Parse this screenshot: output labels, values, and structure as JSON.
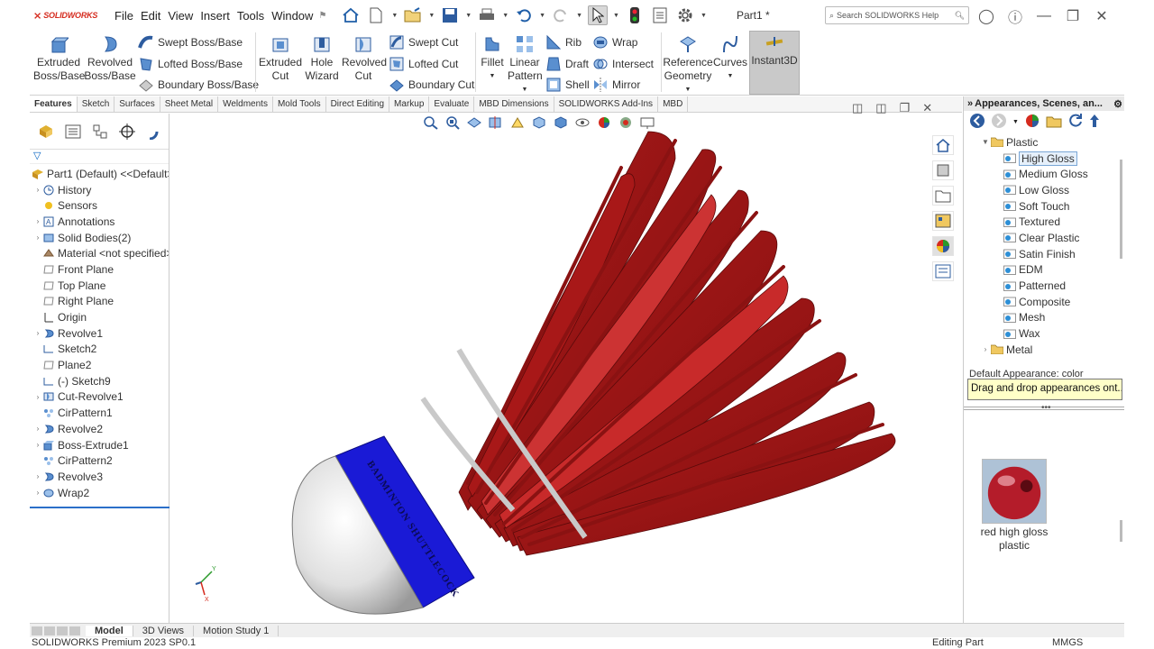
{
  "app": {
    "brand": "SOLIDWORKS",
    "document_title": "Part1 *",
    "search_placeholder": "Search SOLIDWORKS Help"
  },
  "menu": [
    "File",
    "Edit",
    "View",
    "Insert",
    "Tools",
    "Window"
  ],
  "ribbon": {
    "extruded_boss": "Extruded Boss/Base",
    "revolved_boss": "Revolved Boss/Base",
    "swept_boss": "Swept Boss/Base",
    "lofted_boss": "Lofted Boss/Base",
    "boundary_boss": "Boundary Boss/Base",
    "extruded_cut": "Extruded Cut",
    "hole_wizard": "Hole Wizard",
    "revolved_cut": "Revolved Cut",
    "swept_cut": "Swept Cut",
    "lofted_cut": "Lofted Cut",
    "boundary_cut": "Boundary Cut",
    "fillet": "Fillet",
    "linear_pattern": "Linear Pattern",
    "rib": "Rib",
    "draft": "Draft",
    "shell": "Shell",
    "wrap": "Wrap",
    "intersect": "Intersect",
    "mirror": "Mirror",
    "reference_geometry": "Reference Geometry",
    "curves": "Curves",
    "instant3d": "Instant3D"
  },
  "command_tabs": [
    "Features",
    "Sketch",
    "Surfaces",
    "Sheet Metal",
    "Weldments",
    "Mold Tools",
    "Direct Editing",
    "Markup",
    "Evaluate",
    "MBD Dimensions",
    "SOLIDWORKS Add-Ins",
    "MBD"
  ],
  "feature_tree": {
    "root": "Part1 (Default) <<Default>_",
    "items": [
      {
        "label": "History",
        "expand": true,
        "icon": "history"
      },
      {
        "label": "Sensors",
        "expand": false,
        "icon": "sensor"
      },
      {
        "label": "Annotations",
        "expand": true,
        "icon": "annotation"
      },
      {
        "label": "Solid Bodies(2)",
        "expand": true,
        "icon": "bodies"
      },
      {
        "label": "Material <not specified>",
        "expand": false,
        "icon": "material"
      },
      {
        "label": "Front Plane",
        "expand": false,
        "icon": "plane"
      },
      {
        "label": "Top Plane",
        "expand": false,
        "icon": "plane"
      },
      {
        "label": "Right Plane",
        "expand": false,
        "icon": "plane"
      },
      {
        "label": "Origin",
        "expand": false,
        "icon": "origin"
      },
      {
        "label": "Revolve1",
        "expand": true,
        "icon": "revolve"
      },
      {
        "label": "Sketch2",
        "expand": false,
        "icon": "sketch"
      },
      {
        "label": "Plane2",
        "expand": false,
        "icon": "plane"
      },
      {
        "label": "(-) Sketch9",
        "expand": false,
        "icon": "sketch"
      },
      {
        "label": "Cut-Revolve1",
        "expand": true,
        "icon": "cut"
      },
      {
        "label": "CirPattern1",
        "expand": false,
        "icon": "pattern"
      },
      {
        "label": "Revolve2",
        "expand": true,
        "icon": "revolve"
      },
      {
        "label": "Boss-Extrude1",
        "expand": true,
        "icon": "extrude"
      },
      {
        "label": "CirPattern2",
        "expand": false,
        "icon": "pattern"
      },
      {
        "label": "Revolve3",
        "expand": true,
        "icon": "revolve"
      },
      {
        "label": "Wrap2",
        "expand": true,
        "icon": "wrap"
      }
    ]
  },
  "task_pane": {
    "title": "Appearances, Scenes, an...",
    "plastic_label": "Plastic",
    "plastic_items": [
      "High Gloss",
      "Medium Gloss",
      "Low Gloss",
      "Soft Touch",
      "Textured",
      "Clear Plastic",
      "Satin Finish",
      "EDM",
      "Patterned",
      "Composite",
      "Mesh",
      "Wax"
    ],
    "selected_item": "High Gloss",
    "metal_label": "Metal",
    "default_appearance": "Default Appearance: color",
    "tooltip": "Drag and drop appearances ont...",
    "swatch_label": "red high gloss plastic"
  },
  "bottom_tabs": [
    "Model",
    "3D Views",
    "Motion Study 1"
  ],
  "active_bottom_tab": "Model",
  "status": {
    "left": "SOLIDWORKS Premium 2023 SP0.1",
    "mid": "Editing Part",
    "right": "MMGS"
  },
  "model_text": "BADMINTON SHUTTLECOCK",
  "colors": {
    "feather_red": "#9b1414",
    "band_blue": "#1a1ad6",
    "cork_white": "#e8e8e8",
    "tooltip_yellow": "#ffffc8",
    "brand_red": "#d52b1e"
  }
}
